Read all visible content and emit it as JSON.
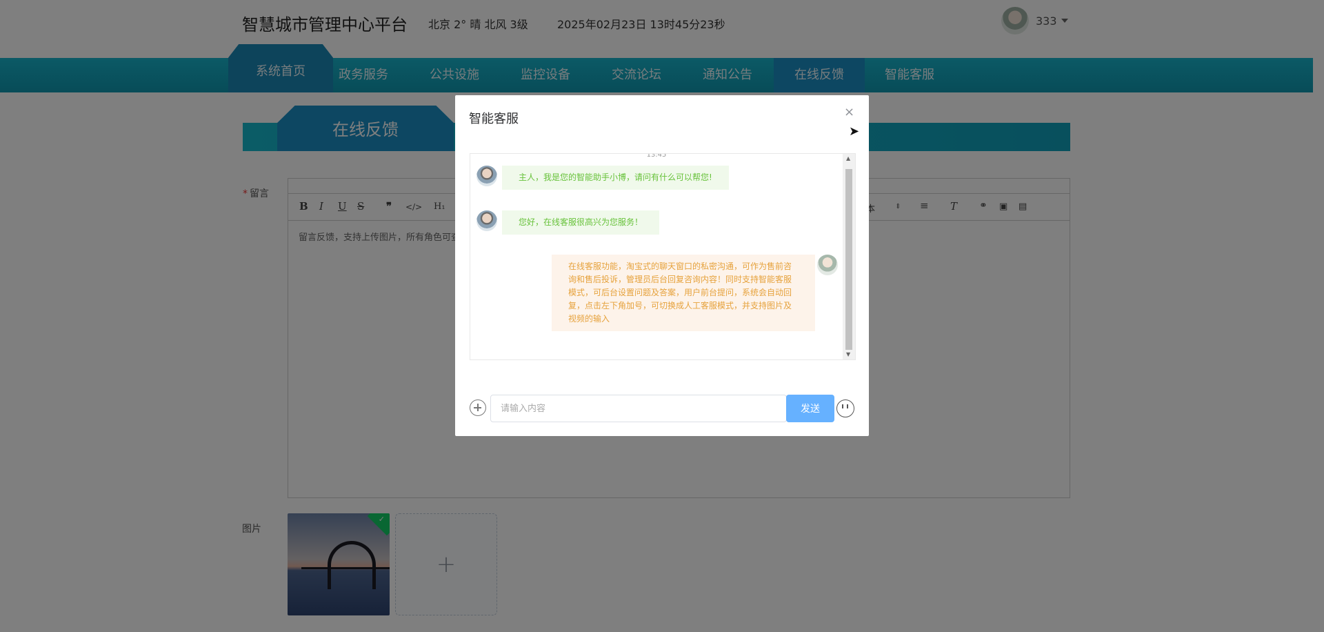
{
  "header": {
    "site_title": "智慧城市管理中心平台",
    "weather": "北京  2°  晴  北风  3级",
    "datetime": "2025年02月23日 13时45分23秒",
    "user_name": "333"
  },
  "nav": {
    "items": [
      "系统首页",
      "政务服务",
      "公共设施",
      "监控设备",
      "交流论坛",
      "通知公告",
      "在线反馈",
      "智能客服"
    ],
    "active": "在线反馈"
  },
  "page": {
    "section_title": "在线反馈",
    "message_label": "留言",
    "editor_placeholder": "留言反馈，支持上传图片，所有角色可查",
    "toolbar_font": "本",
    "image_label": "图片",
    "upload_plus": "+"
  },
  "dialog": {
    "title": "智能客服",
    "close": "×",
    "time": "13:45",
    "messages": [
      {
        "from": "bot",
        "text": "主人，我是您的智能助手小博，请问有什么可以帮您!"
      },
      {
        "from": "bot",
        "text": "您好，在线客服很高兴为您服务！"
      },
      {
        "from": "user",
        "text": "在线客服功能，淘宝式的聊天窗口的私密沟通，可作为售前咨询和售后投诉，管理员后台回复咨询内容！同时支持智能客服模式，可后台设置问题及答案，用户前台提问，系统会自动回复，点击左下角加号，可切换成人工客服模式，并支持图片及视频的输入"
      }
    ],
    "input_placeholder": "请输入内容",
    "send_label": "发送"
  },
  "colors": {
    "nav_bg": "#13a9c2",
    "nav_active": "#1a8fc4",
    "send_button": "#66b1ff",
    "bot_text": "#67c23a",
    "user_text": "#e6a23c"
  }
}
